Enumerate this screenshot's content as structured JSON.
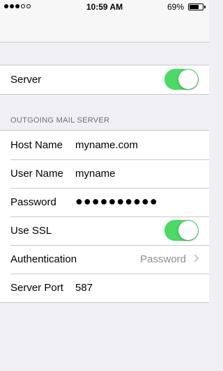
{
  "status_bar": {
    "signal": "●●●○○",
    "time": "10:59 AM",
    "battery": "69%",
    "battery_level": 0.69
  },
  "server_row": {
    "label": "Server",
    "toggle_on": true
  },
  "outgoing": {
    "header": "OUTGOING MAIL SERVER",
    "host_name": {
      "label": "Host Name",
      "value": "myname.com"
    },
    "user_name": {
      "label": "User Name",
      "value": "myname"
    },
    "password": {
      "label": "Password",
      "value": "●●●●●●●●●●"
    },
    "use_ssl": {
      "label": "Use SSL",
      "toggle_on": true
    },
    "authentication": {
      "label": "Authentication",
      "value": "Password"
    },
    "server_port": {
      "label": "Server Port",
      "value": "587"
    }
  },
  "colors": {
    "toggle_on": "#4cd964",
    "background": "#efeff4",
    "separator": "#c8c7cc",
    "secondary_text": "#8e8e93"
  },
  "icons": [
    "signal-icon",
    "battery-icon",
    "chevron-right-icon"
  ]
}
